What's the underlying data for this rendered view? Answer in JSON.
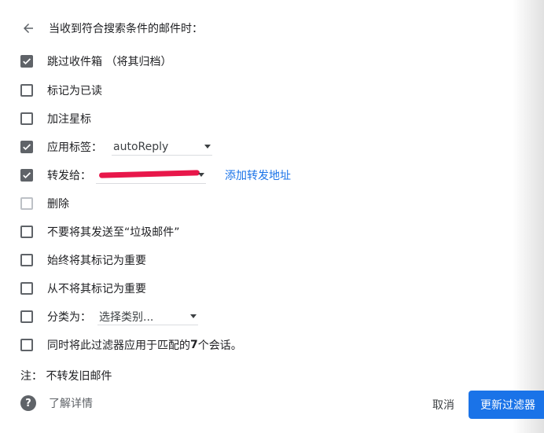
{
  "header": {
    "title": "当收到符合搜索条件的邮件时："
  },
  "options": [
    {
      "label": "跳过收件箱 （将其归档）",
      "checked": true
    },
    {
      "label": "标记为已读",
      "checked": false
    },
    {
      "label": "加注星标",
      "checked": false
    },
    {
      "label": "应用标签：",
      "checked": true,
      "select_value": "autoReply"
    },
    {
      "label": "转发给：",
      "checked": true,
      "select_value": "",
      "link": "添加转发地址"
    },
    {
      "label": "删除",
      "checked": false,
      "disabled": true
    },
    {
      "label": "不要将其发送至“垃圾邮件”",
      "checked": false
    },
    {
      "label": "始终将其标记为重要",
      "checked": false
    },
    {
      "label": "从不将其标记为重要",
      "checked": false
    },
    {
      "label": "分类为：",
      "checked": false,
      "select_value": "选择类别..."
    },
    {
      "label_prefix": "同时将此过滤器应用于匹配的 ",
      "count": "7",
      "label_suffix": " 个会话。",
      "checked": false
    }
  ],
  "note": "注：  不转发旧邮件",
  "footer": {
    "help_icon_glyph": "?",
    "learn_more": "了解详情",
    "cancel": "取消",
    "update_filter": "更新过滤器"
  },
  "colors": {
    "primary": "#1a73e8",
    "checkbox": "#5f6368",
    "redaction": "#e8174a"
  }
}
